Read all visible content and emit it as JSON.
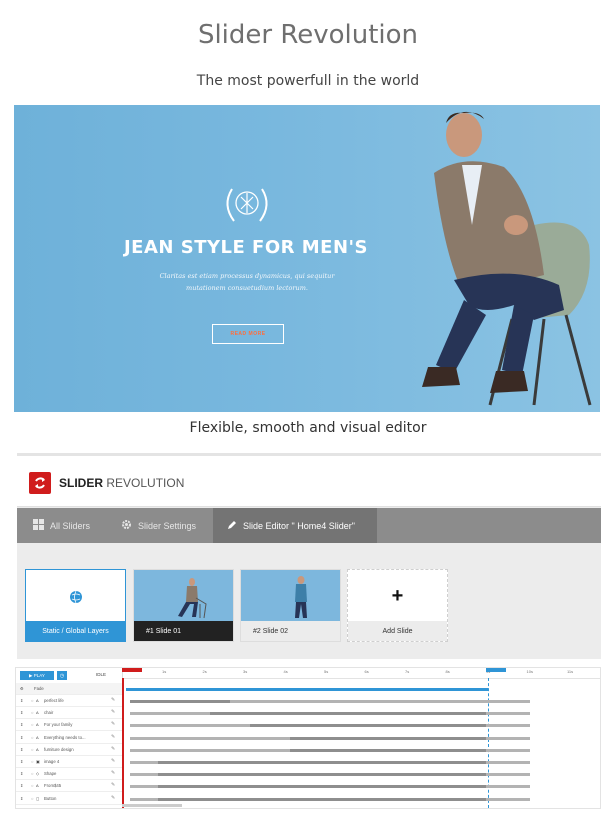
{
  "page": {
    "title": "Slider Revolution",
    "subtitle": "The most powerfull in the world",
    "caption": "Flexible, smooth and visual editor"
  },
  "hero": {
    "heading": "JEAN STYLE FOR MEN'S",
    "text": "Claritas est etiam processus dynamicus, qui sequitur mutationem consuetudium lectorum.",
    "button_label": "READ MORE",
    "accent_color": "#ff6e3c"
  },
  "editor": {
    "brand_bold": "SLIDER",
    "brand_light": "REVOLUTION",
    "brand_color": "#d01c1c",
    "tabs": [
      {
        "label": "All Sliders",
        "icon": "grid-icon"
      },
      {
        "label": "Slider Settings",
        "icon": "gear-icon"
      },
      {
        "label": "Slide Editor \" Home4 Slider\"",
        "icon": "pencil-icon"
      }
    ],
    "slides": [
      {
        "label": "Static / Global Layers",
        "icon": "globe-icon"
      },
      {
        "label": "#1 Slide 01"
      },
      {
        "label": "#2 Slide 02"
      },
      {
        "label": "Add Slide",
        "icon": "plus-icon"
      }
    ]
  },
  "timeline": {
    "play_label": "PLAY",
    "status": "IDLE",
    "header_row": "Fade",
    "ruler": [
      "1s",
      "2s",
      "3s",
      "4s",
      "5s",
      "6s",
      "7s",
      "8s",
      "9s",
      "10s",
      "11s"
    ],
    "layers": [
      {
        "name": "perfect life",
        "icon": "text-icon",
        "start": 0.0,
        "end": 0.25
      },
      {
        "name": "chair",
        "icon": "text-icon",
        "start": 0.2,
        "end": 0.89
      },
      {
        "name": "For your family",
        "icon": "text-icon",
        "start": 0.3,
        "end": 0.89
      },
      {
        "name": "Everything needs to...",
        "icon": "text-icon",
        "start": 0.4,
        "end": 0.89
      },
      {
        "name": "furniture design",
        "icon": "text-icon",
        "start": 0.4,
        "end": 0.89
      },
      {
        "name": "image 4",
        "icon": "image-icon",
        "start": 0.07,
        "end": 0.89
      },
      {
        "name": "Shape",
        "icon": "shape-icon",
        "start": 0.07,
        "end": 0.89
      },
      {
        "name": "From$45",
        "icon": "text-icon",
        "start": 0.07,
        "end": 0.89
      },
      {
        "name": "Button",
        "icon": "button-icon",
        "start": 0.07,
        "end": 0.89
      }
    ]
  }
}
